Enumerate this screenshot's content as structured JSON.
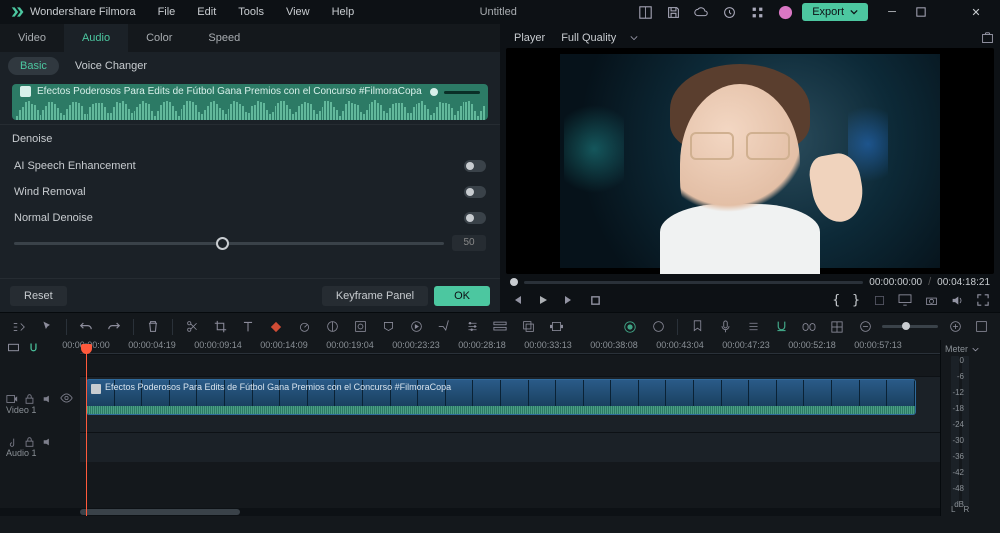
{
  "app": {
    "name": "Wondershare Filmora",
    "doc": "Untitled"
  },
  "menu": [
    "File",
    "Edit",
    "Tools",
    "View",
    "Help"
  ],
  "export": "Export",
  "tabs1": [
    "Video",
    "Audio",
    "Color",
    "Speed"
  ],
  "tabs1_active": 1,
  "tabs2": [
    "Basic",
    "Voice Changer"
  ],
  "tabs2_active": 0,
  "clip_title": "Efectos Poderosos Para Edits de Fútbol   Gana Premios con el Concurso #FilmoraCopa",
  "denoise": {
    "header": "Denoise",
    "opt1": "AI Speech Enhancement",
    "opt2": "Wind Removal",
    "opt3": "Normal Denoise",
    "val": "50"
  },
  "left_footer": {
    "reset": "Reset",
    "keyframe": "Keyframe Panel",
    "ok": "OK"
  },
  "player": {
    "label": "Player",
    "quality": "Full Quality",
    "cur": "00:00:00:00",
    "total": "00:04:18:21"
  },
  "timecodes": [
    "00:00:00:00",
    "00:00:04:19",
    "00:00:09:14",
    "00:00:14:09",
    "00:00:19:04",
    "00:00:23:23",
    "00:00:28:18",
    "00:00:33:13",
    "00:00:38:08",
    "00:00:43:04",
    "00:00:47:23",
    "00:00:52:18",
    "00:00:57:13"
  ],
  "tracks": {
    "video": "Video 1",
    "audio": "Audio 1"
  },
  "meter": {
    "label": "Meter",
    "marks": [
      "0",
      "-6",
      "-12",
      "-18",
      "-24",
      "-30",
      "-36",
      "-42",
      "-48",
      "dB"
    ],
    "L": "L",
    "R": "R"
  }
}
